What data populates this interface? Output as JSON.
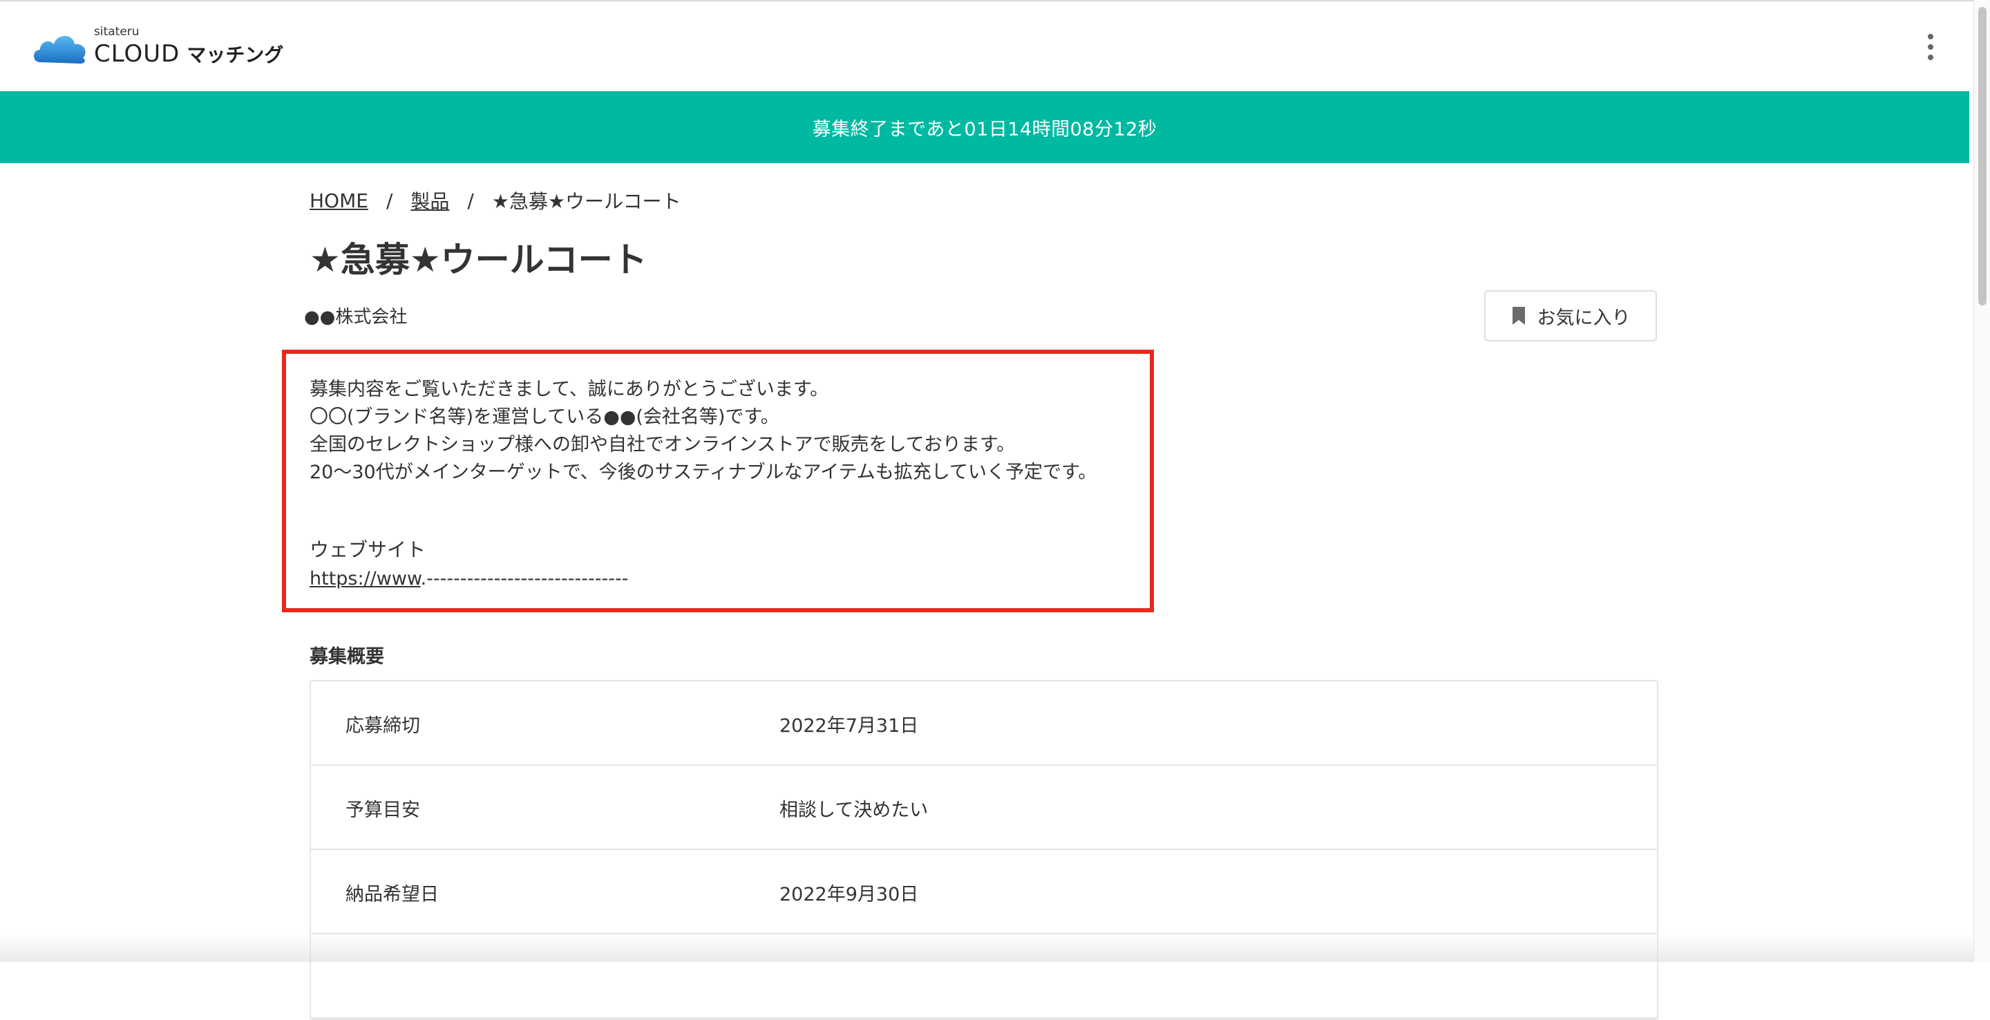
{
  "header": {
    "logo_small": "sitateru",
    "logo_brand": "CLOUD",
    "logo_product": "マッチング",
    "menu_icon": "kebab-menu-icon"
  },
  "banner": {
    "countdown": "募集終了まであと01日14時間08分12秒",
    "color": "#00b9a1"
  },
  "breadcrumb": {
    "home": "HOME",
    "separator": "/",
    "category": "製品",
    "current": "★急募★ウールコート"
  },
  "page": {
    "title": "★急募★ウールコート",
    "company": "●●株式会社",
    "favorite_label": "お気に入り",
    "favorite_icon": "bookmark-icon"
  },
  "intro": {
    "lines": [
      "募集内容をご覧いただきまして、誠にありがとうございます。",
      "〇〇(ブランド名等)を運営している●●(会社名等)です。",
      "全国のセレクトショップ様への卸や自社でオンラインストアで販売をしております。",
      "20〜30代がメインターゲットで、今後のサスティナブルなアイテムも拡充していく予定です。"
    ],
    "website_label": "ウェブサイト",
    "website_url": "https://www",
    "website_rest": ".------------------------------",
    "highlight_color": "#e8291b"
  },
  "summary": {
    "title": "募集概要",
    "rows": [
      {
        "label": "応募締切",
        "value": "2022年7月31日"
      },
      {
        "label": "予算目安",
        "value": "相談して決めたい"
      },
      {
        "label": "納品希望日",
        "value": "2022年9月30日"
      }
    ]
  }
}
